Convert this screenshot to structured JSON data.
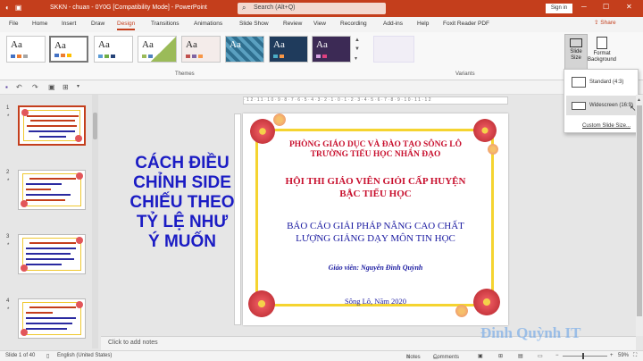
{
  "titlebar": {
    "document_title": "SKKN - chuan - 0Y0G [Compatibility Mode] - PowerPoint",
    "search_placeholder": "Search (Alt+Q)",
    "signin_label": "Sign in",
    "qat_icons": [
      "save-icon",
      "undo-icon",
      "redo-icon",
      "present-icon"
    ]
  },
  "ribbon_tabs": [
    "File",
    "Home",
    "Insert",
    "Draw",
    "Design",
    "Transitions",
    "Animations",
    "Slide Show",
    "Review",
    "View",
    "Recording",
    "Add-ins",
    "Help",
    "Foxit Reader PDF"
  ],
  "active_tab": "Design",
  "share_label": "Share",
  "ribbon": {
    "themes_label": "Themes",
    "variants_label": "Variants",
    "theme_thumb_text": "Aa",
    "slide_size_label_1": "Slide",
    "slide_size_label_2": "Size",
    "format_bg_label_1": "Format",
    "format_bg_label_2": "Background"
  },
  "slide_size_menu": {
    "standard": "Standard (4:3)",
    "widescreen": "Widescreen (16:9)",
    "custom": "Custom Slide Size..."
  },
  "thumbnails": [
    {
      "number": "1",
      "star": "*",
      "selected": true
    },
    {
      "number": "2",
      "star": "*",
      "selected": false
    },
    {
      "number": "3",
      "star": "*",
      "selected": false
    },
    {
      "number": "4",
      "star": "*",
      "selected": false
    }
  ],
  "overlay_text": [
    "CÁCH ĐIỀU",
    "CHỈNH SIDE",
    "CHIẾU THEO",
    "TỶ LỆ NHƯ",
    "Ý MUỐN"
  ],
  "slide": {
    "org_line1": "PHÒNG GIÁO DỤC VÀ ĐÀO TẠO SÔNG LÔ",
    "org_line2": "TRƯỜNG TIỂU HỌC NHÂN ĐẠO",
    "contest_line1": "HỘI THI GIÁO VIÊN GIỎI CẤP HUYỆN",
    "contest_line2": "BẬC TIỂU HỌC",
    "topic_line1": "BÁO CÁO GIẢI PHÁP NÂNG CAO CHẤT",
    "topic_line2": "LƯỢNG GIẢNG DẠY MÔN TIN HỌC",
    "teacher": "Giáo viên: Nguyễn Đình Quỳnh",
    "place_date": "Sông Lô, Năm 2020"
  },
  "notes_placeholder": "Click to add notes",
  "watermark": "Đinh Quỳnh IT",
  "statusbar": {
    "slide_count": "Slide 1 of 40",
    "language": "English (United States)",
    "notes": "Notes",
    "comments": "Comments",
    "zoom": "59%"
  },
  "colors": {
    "accent": "#c43e1c",
    "overlay_text": "#1b1cc4",
    "slide_red": "#c8102e",
    "slide_blue": "#1a1aa0",
    "frame_yellow": "#f5d430"
  }
}
